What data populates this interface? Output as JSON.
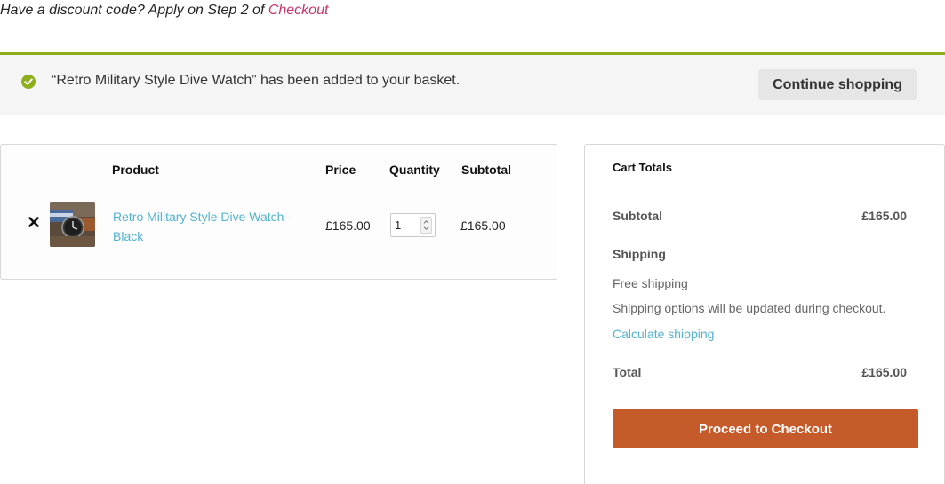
{
  "notice": {
    "discount_text": "Have a discount code? Apply on Step 2 of ",
    "checkout_link": "Checkout"
  },
  "message": {
    "text": "“Retro Military Style Dive Watch” has been added to your basket.",
    "continue_label": "Continue shopping"
  },
  "cart": {
    "headers": {
      "product": "Product",
      "price": "Price",
      "quantity": "Quantity",
      "subtotal": "Subtotal"
    },
    "items": [
      {
        "name": "Retro Military Style Dive Watch - Black",
        "price": "£165.00",
        "quantity": "1",
        "subtotal": "£165.00"
      }
    ]
  },
  "totals": {
    "title": "Cart Totals",
    "subtotal_label": "Subtotal",
    "subtotal_value": "£165.00",
    "shipping_label": "Shipping",
    "shipping_method": "Free shipping",
    "shipping_note": "Shipping options will be updated during checkout.",
    "calculate_label": "Calculate shipping",
    "total_label": "Total",
    "total_value": "£165.00",
    "checkout_label": "Proceed to Checkout"
  },
  "colors": {
    "accent_green": "#8fae1b",
    "link_blue": "#53b3cf",
    "link_pink": "#c7336c",
    "checkout_orange": "#c55b2a"
  }
}
